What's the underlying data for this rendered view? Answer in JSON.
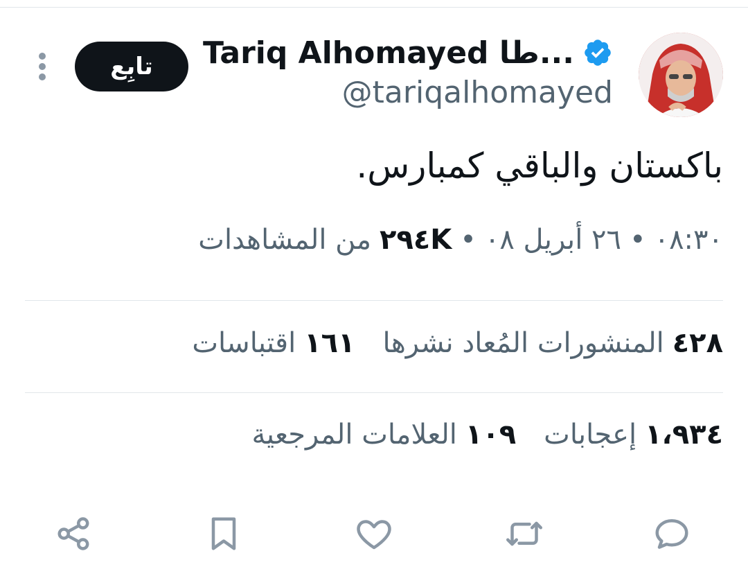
{
  "author": {
    "display_name": "Tariq Alhomayed طا...",
    "handle": "@tariqalhomayed",
    "verified_icon": "verified-badge-icon",
    "avatar_icon": "profile-avatar"
  },
  "follow_button": {
    "label": "تابِع"
  },
  "more_menu": {
    "icon": "more-vertical-icon"
  },
  "tweet": {
    "text": "باكستان والباقي كمبارس."
  },
  "meta": {
    "time": "٠٨:٣٠",
    "separator": "•",
    "date": "٢٦ أبريل ٠٨",
    "views_count": "٢٩٤K",
    "views_label": "من المشاهدات"
  },
  "stats_row1": [
    {
      "count": "٤٢٨",
      "label": "المنشورات المُعاد نشرها"
    },
    {
      "count": "١٦١",
      "label": "اقتباسات"
    }
  ],
  "stats_row2": [
    {
      "count": "١،٩٣٤",
      "label": "إعجابات"
    },
    {
      "count": "١٠٩",
      "label": "العلامات المرجعية"
    }
  ],
  "actions": [
    {
      "name": "reply",
      "icon": "reply-icon"
    },
    {
      "name": "repost",
      "icon": "repost-icon"
    },
    {
      "name": "like",
      "icon": "heart-icon"
    },
    {
      "name": "bookmark",
      "icon": "bookmark-icon"
    },
    {
      "name": "share",
      "icon": "share-icon"
    }
  ],
  "colors": {
    "text_primary": "#0f1419",
    "text_secondary": "#536471",
    "verified_blue": "#1d9bf0",
    "divider": "#e1e6ea",
    "icon_gray": "#8b98a5"
  }
}
